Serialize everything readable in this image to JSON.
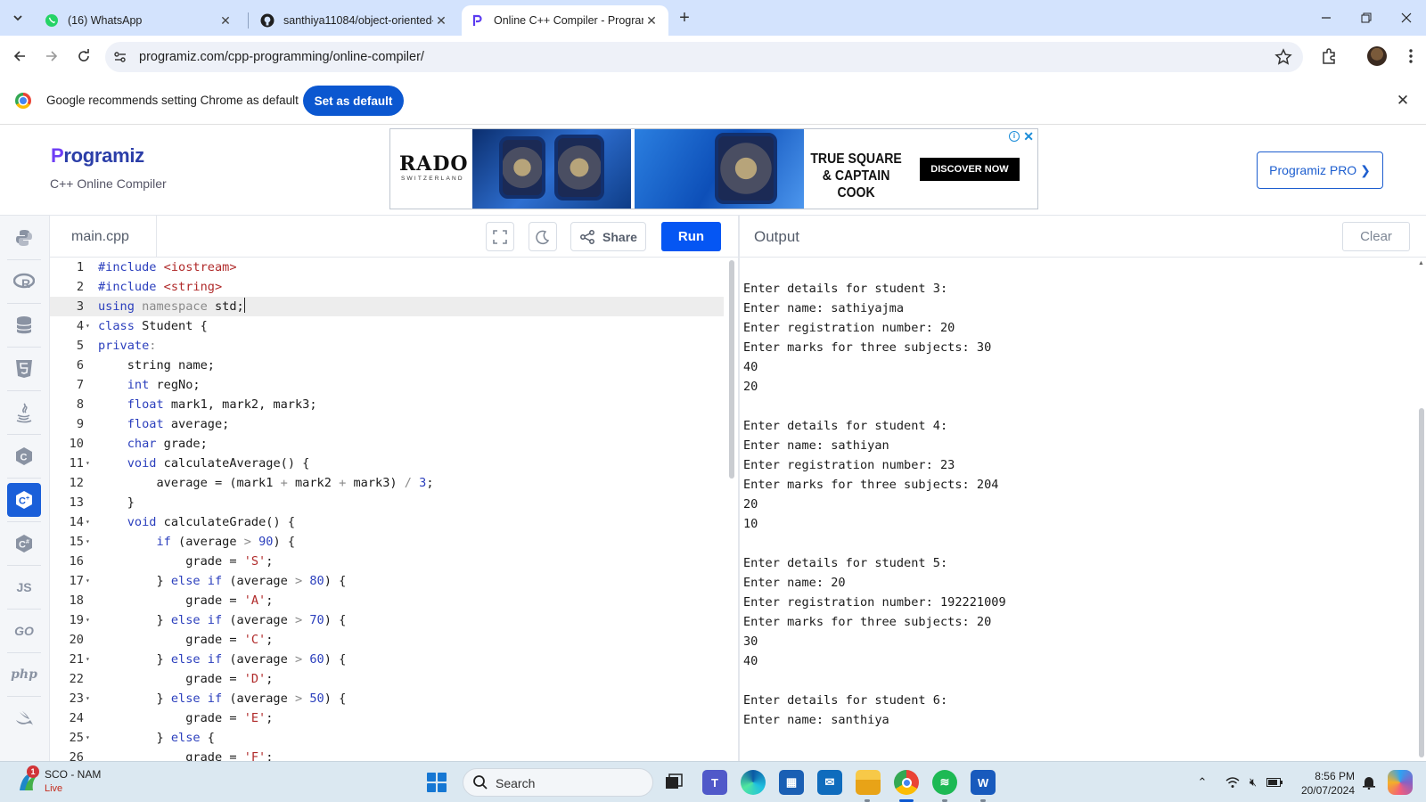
{
  "browser": {
    "tabs": [
      {
        "title": "(16) WhatsApp",
        "icon": "whatsapp-icon",
        "active": false
      },
      {
        "title": "santhiya11084/object-oriented-",
        "icon": "github-icon",
        "active": false
      },
      {
        "title": "Online C++ Compiler - Program",
        "icon": "programiz-icon",
        "active": true
      }
    ],
    "url": "programiz.com/cpp-programming/online-compiler/"
  },
  "infobar": {
    "message": "Google recommends setting Chrome as default",
    "button": "Set as default"
  },
  "header": {
    "logo": "rogramiz",
    "logo_initial": "P",
    "subtitle": "C++ Online Compiler",
    "pro_button": "Programiz PRO ❯"
  },
  "ad": {
    "brand": "RADO",
    "brand_sub": "SWITZERLAND",
    "headline": "TRUE SQUARE & CAPTAIN COOK",
    "cta": "DISCOVER NOW"
  },
  "languages": [
    {
      "name": "python-icon",
      "label": "",
      "active": false
    },
    {
      "name": "r-icon",
      "label": "",
      "active": false
    },
    {
      "name": "sql-icon",
      "label": "",
      "active": false
    },
    {
      "name": "html5-icon",
      "label": "",
      "active": false
    },
    {
      "name": "java-icon",
      "label": "",
      "active": false
    },
    {
      "name": "c-icon",
      "label": "",
      "active": false
    },
    {
      "name": "cpp-icon",
      "label": "",
      "active": true
    },
    {
      "name": "csharp-icon",
      "label": "",
      "active": false
    },
    {
      "name": "javascript-icon",
      "label": "JS",
      "active": false
    },
    {
      "name": "go-icon",
      "label": "GO",
      "active": false
    },
    {
      "name": "php-icon",
      "label": "php",
      "active": false
    },
    {
      "name": "swift-icon",
      "label": "",
      "active": false
    }
  ],
  "editor": {
    "filename": "main.cpp",
    "share_label": "Share",
    "run_label": "Run",
    "highlighted_line": 3,
    "lines": [
      {
        "n": "1",
        "fold": false,
        "html": "<span class=\"kw\">#include</span> <span class=\"str\">&lt;iostream&gt;</span>"
      },
      {
        "n": "2",
        "fold": false,
        "html": "<span class=\"kw\">#include</span> <span class=\"str\">&lt;string&gt;</span>"
      },
      {
        "n": "3",
        "fold": false,
        "html": "<span class=\"kw\">using</span> <span class=\"op\">namespace</span> std;<span class=\"cursor\"></span>"
      },
      {
        "n": "4",
        "fold": true,
        "html": "<span class=\"kw\">class</span> Student {"
      },
      {
        "n": "5",
        "fold": false,
        "html": "<span class=\"kw\">private</span><span class=\"op\">:</span>"
      },
      {
        "n": "6",
        "fold": false,
        "html": "    string name;"
      },
      {
        "n": "7",
        "fold": false,
        "html": "    <span class=\"kw\">int</span> regNo;"
      },
      {
        "n": "8",
        "fold": false,
        "html": "    <span class=\"kw\">float</span> mark1, mark2, mark3;"
      },
      {
        "n": "9",
        "fold": false,
        "html": "    <span class=\"kw\">float</span> average;"
      },
      {
        "n": "10",
        "fold": false,
        "html": "    <span class=\"kw\">char</span> grade;"
      },
      {
        "n": "11",
        "fold": true,
        "html": "    <span class=\"kw\">void</span> calculateAverage() {"
      },
      {
        "n": "12",
        "fold": false,
        "html": "        average = (mark1 <span class=\"op\">+</span> mark2 <span class=\"op\">+</span> mark3) <span class=\"op\">/</span> <span class=\"num\">3</span>;"
      },
      {
        "n": "13",
        "fold": false,
        "html": "    }"
      },
      {
        "n": "14",
        "fold": true,
        "html": "    <span class=\"kw\">void</span> calculateGrade() {"
      },
      {
        "n": "15",
        "fold": true,
        "html": "        <span class=\"kw\">if</span> (average <span class=\"op\">&gt;</span> <span class=\"num\">90</span>) {"
      },
      {
        "n": "16",
        "fold": false,
        "html": "            grade = <span class=\"str\">'S'</span>;"
      },
      {
        "n": "17",
        "fold": true,
        "html": "        } <span class=\"kw\">else if</span> (average <span class=\"op\">&gt;</span> <span class=\"num\">80</span>) {"
      },
      {
        "n": "18",
        "fold": false,
        "html": "            grade = <span class=\"str\">'A'</span>;"
      },
      {
        "n": "19",
        "fold": true,
        "html": "        } <span class=\"kw\">else if</span> (average <span class=\"op\">&gt;</span> <span class=\"num\">70</span>) {"
      },
      {
        "n": "20",
        "fold": false,
        "html": "            grade = <span class=\"str\">'C'</span>;"
      },
      {
        "n": "21",
        "fold": true,
        "html": "        } <span class=\"kw\">else if</span> (average <span class=\"op\">&gt;</span> <span class=\"num\">60</span>) {"
      },
      {
        "n": "22",
        "fold": false,
        "html": "            grade = <span class=\"str\">'D'</span>;"
      },
      {
        "n": "23",
        "fold": true,
        "html": "        } <span class=\"kw\">else if</span> (average <span class=\"op\">&gt;</span> <span class=\"num\">50</span>) {"
      },
      {
        "n": "24",
        "fold": false,
        "html": "            grade = <span class=\"str\">'E'</span>;"
      },
      {
        "n": "25",
        "fold": true,
        "html": "        } <span class=\"kw\">else</span> {"
      },
      {
        "n": "26",
        "fold": false,
        "html": "            grade = <span class=\"str\">'F'</span>;"
      }
    ]
  },
  "output": {
    "title": "Output",
    "clear_label": "Clear",
    "lines": [
      "Enter details for student 3:",
      "Enter name: sathiyajma",
      "Enter registration number: 20",
      "Enter marks for three subjects: 30",
      "40",
      "20",
      "",
      "Enter details for student 4:",
      "Enter name: sathiyan",
      "Enter registration number: 23",
      "Enter marks for three subjects: 204",
      "20",
      "10",
      "",
      "Enter details for student 5:",
      "Enter name: 20",
      "Enter registration number: 192221009",
      "Enter marks for three subjects: 20",
      "30",
      "40",
      "",
      "Enter details for student 6:",
      "Enter name: santhiya"
    ]
  },
  "taskbar": {
    "weather_title": "SCO - NAM",
    "weather_sub": "Live",
    "notification_count": "1",
    "search_label": "Search",
    "time": "8:56 PM",
    "date": "20/07/2024"
  }
}
